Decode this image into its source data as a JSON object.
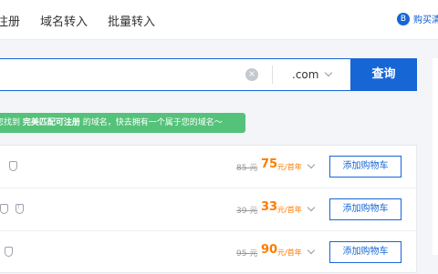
{
  "nav": {
    "items": [
      "注册",
      "域名转入",
      "批量转入"
    ],
    "cart_label": "购买清",
    "cart_badge": "B"
  },
  "search": {
    "clear_icon": "×",
    "tld_value": ".com",
    "button_label": "查询"
  },
  "tip": {
    "prefix": "您找到",
    "highlight": "完美匹配可注册",
    "suffix": "的域名，快去拥有一个属于您的域名～"
  },
  "results": [
    {
      "old_price": "85 元",
      "price": "75",
      "unit": "元/首年",
      "add_label": "添加购物车",
      "badges": [
        "shield-icon"
      ]
    },
    {
      "old_price": "39 元",
      "price": "33",
      "unit": "元/首年",
      "add_label": "添加购物车",
      "badges": [
        "shield-icon",
        "info-shield-icon"
      ]
    },
    {
      "old_price": "95 元",
      "price": "90",
      "unit": "元/首年",
      "add_label": "添加购物车",
      "badges": [
        "shield-icon"
      ]
    }
  ],
  "colors": {
    "accent": "#1766d6",
    "price": "#ff7a00",
    "tip_bg": "#55c27a"
  }
}
